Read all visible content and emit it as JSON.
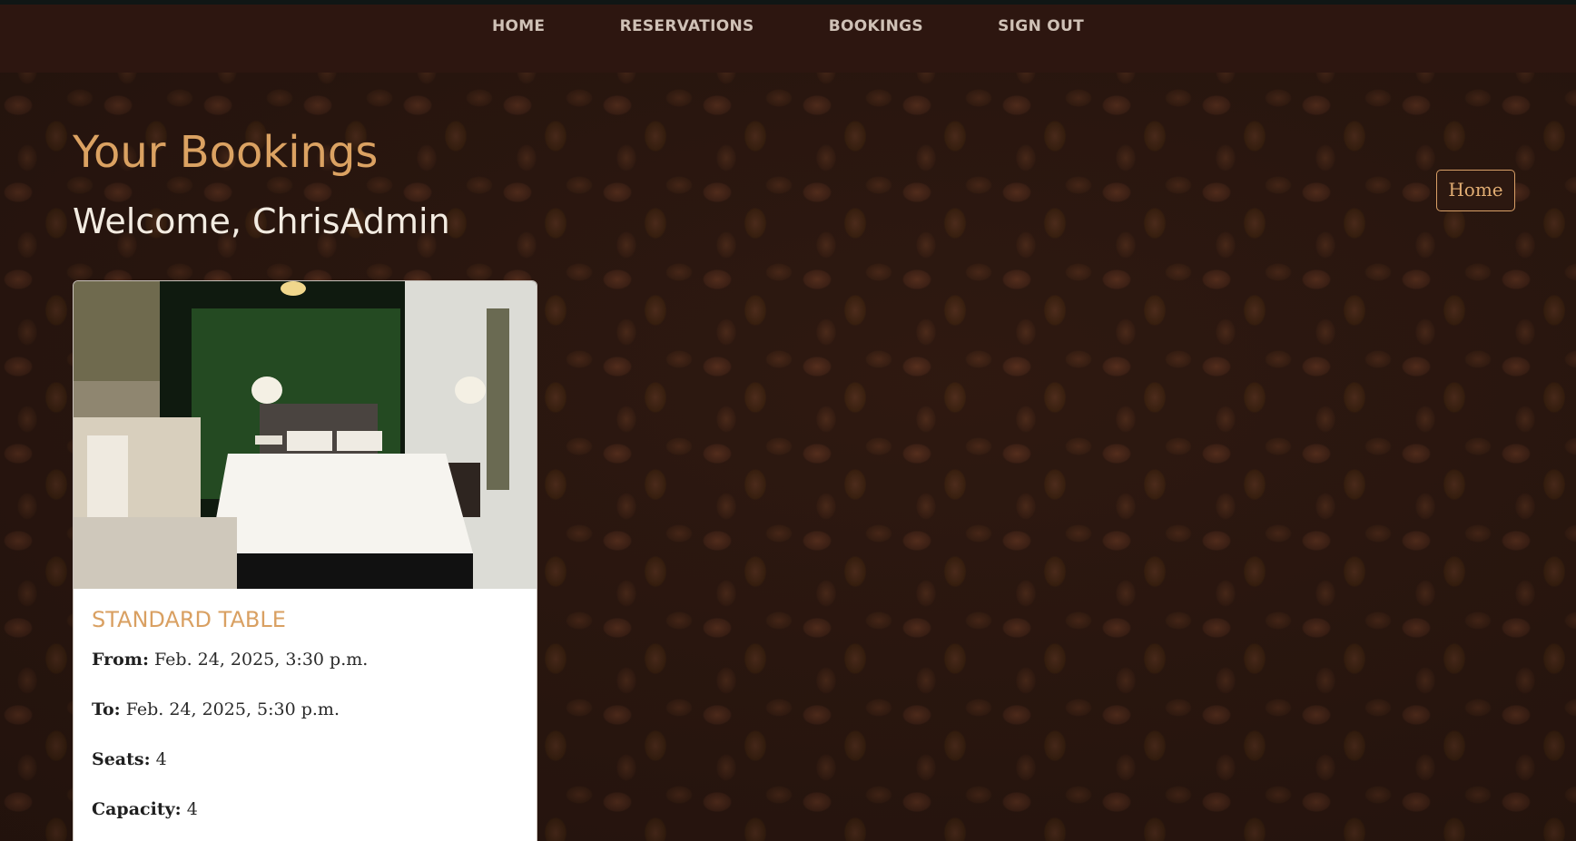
{
  "nav": {
    "items": [
      {
        "label": "HOME"
      },
      {
        "label": "RESERVATIONS"
      },
      {
        "label": "BOOKINGS"
      },
      {
        "label": "SIGN OUT"
      }
    ]
  },
  "page": {
    "heading": "Your Bookings",
    "welcome": "Welcome, ChrisAdmin",
    "home_button": "Home"
  },
  "booking": {
    "title": "STANDARD TABLE",
    "from_label": "From:",
    "from_value": "Feb. 24, 2025, 3:30 p.m.",
    "to_label": "To:",
    "to_value": "Feb. 24, 2025, 5:30 p.m.",
    "seats_label": "Seats:",
    "seats_value": "4",
    "capacity_label": "Capacity:",
    "capacity_value": "4"
  },
  "colors": {
    "accent": "#dba262",
    "nav_background": "#2d1610",
    "nav_text": "#cfc1b6",
    "welcome_text": "#f3ece2"
  }
}
